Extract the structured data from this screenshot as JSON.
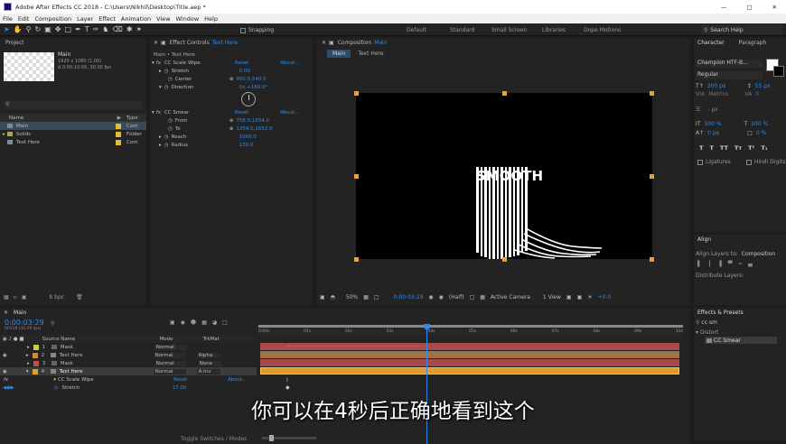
{
  "title_bar": {
    "app": "Adobe After Effects CC 2018 - C:\\Users\\Nikhil\\Desktop\\Title.aep *"
  },
  "menu": [
    "File",
    "Edit",
    "Composition",
    "Layer",
    "Effect",
    "Animation",
    "View",
    "Window",
    "Help"
  ],
  "toolbar": {
    "snapping": "Snapping",
    "workspaces": [
      "Default",
      "Standard",
      "Small Screen",
      "Libraries",
      "Dope Motions"
    ],
    "search_placeholder": "Search Help"
  },
  "project": {
    "tab": "Project",
    "comp_name": "Main",
    "comp_info1": "1920 x 1080 (1.00)",
    "comp_info2": "Δ 0:00:10:00, 30.00 fps",
    "cols": {
      "name": "Name",
      "type": "Type"
    },
    "items": [
      {
        "name": "Main",
        "type": "Com"
      },
      {
        "name": "Solids",
        "type": "Folder"
      },
      {
        "name": "Text Here",
        "type": "Com"
      }
    ],
    "bpc": "8 bpc"
  },
  "effect_controls": {
    "tab": "Effect Controls",
    "tab_target": "Text Here",
    "header": "Main • Text Here",
    "effects": [
      {
        "name": "CC Scale Wipe",
        "reset": "Reset",
        "about": "About...",
        "props": [
          {
            "name": "Stretch",
            "value": "0.00"
          },
          {
            "name": "Center",
            "value": "960.0,540.0"
          },
          {
            "name": "Direction",
            "value": "0x +180.0°"
          }
        ]
      },
      {
        "name": "CC Smear",
        "reset": "Reset",
        "about": "About...",
        "props": [
          {
            "name": "From",
            "value": "758.0,1654.0"
          },
          {
            "name": "To",
            "value": "1254.0,1652.0"
          },
          {
            "name": "Reach",
            "value": "1000.0"
          },
          {
            "name": "Radius",
            "value": "130.0"
          }
        ]
      }
    ]
  },
  "composition": {
    "tab": "Composition",
    "tab_target": "Main",
    "breadcrumbs": [
      "Main",
      "Text Here"
    ],
    "canvas_text": "SMOOTH",
    "footer": {
      "zoom": "50%",
      "time": "0:00:03:29",
      "resolution": "(Half)",
      "camera": "Active Camera",
      "view": "1 View",
      "exposure": "+0.0"
    }
  },
  "character": {
    "tabs": [
      "Character",
      "Paragraph"
    ],
    "font": "Champion HTF-B...",
    "style": "Regular",
    "size": "200 px",
    "leading": "55 px",
    "kerning": "Metrics",
    "tracking": "0",
    "stroke": "- px",
    "vscale": "100 %",
    "hscale": "100 %",
    "baseline": "0 px",
    "tsume": "0 %",
    "ligatures": "Ligatures",
    "hindi": "Hindi Digits"
  },
  "align": {
    "tab": "Align",
    "align_to_label": "Align Layers to:",
    "align_to": "Composition",
    "distribute": "Distribute Layers:"
  },
  "effects_presets": {
    "tab": "Effects & Presets",
    "search": "cc sm",
    "category": "Distort",
    "item": "CC Smear"
  },
  "timeline": {
    "tab": "Main",
    "time": "0:00:03:29",
    "frames": "00119 (30.00 fps)",
    "cols": {
      "source": "Source Name",
      "mode": "Mode",
      "trkmat": "TrkMat"
    },
    "layers": [
      {
        "num": "1",
        "name": "Mask",
        "mode": "Normal",
        "trkmat": "",
        "color": "#c0d040",
        "bar": "#a84a4a"
      },
      {
        "num": "2",
        "name": "Text Here",
        "mode": "Normal",
        "trkmat": "Alpha",
        "color": "#d08a30",
        "bar": "#a84a4a"
      },
      {
        "num": "3",
        "name": "Mask",
        "mode": "Normal",
        "trkmat": "None",
        "color": "#c05050",
        "bar": "#a84a4a"
      },
      {
        "num": "4",
        "name": "Text Here",
        "mode": "Normal",
        "trkmat": "A.Inv",
        "color": "#e0a030",
        "bar": "#e09a2a"
      }
    ],
    "sub_effect": "CC Scale Wipe",
    "sub_reset": "Reset",
    "sub_about": "About...",
    "sub_prop": "Stretch",
    "sub_value": "17.00",
    "ruler": [
      "0:00s",
      "01s",
      "02s",
      "03s",
      "04s",
      "05s",
      "06s",
      "07s",
      "08s",
      "09s",
      "10s"
    ],
    "footer": "Toggle Switches / Modes"
  },
  "subtitle": "你可以在4秒后正确地看到这个"
}
